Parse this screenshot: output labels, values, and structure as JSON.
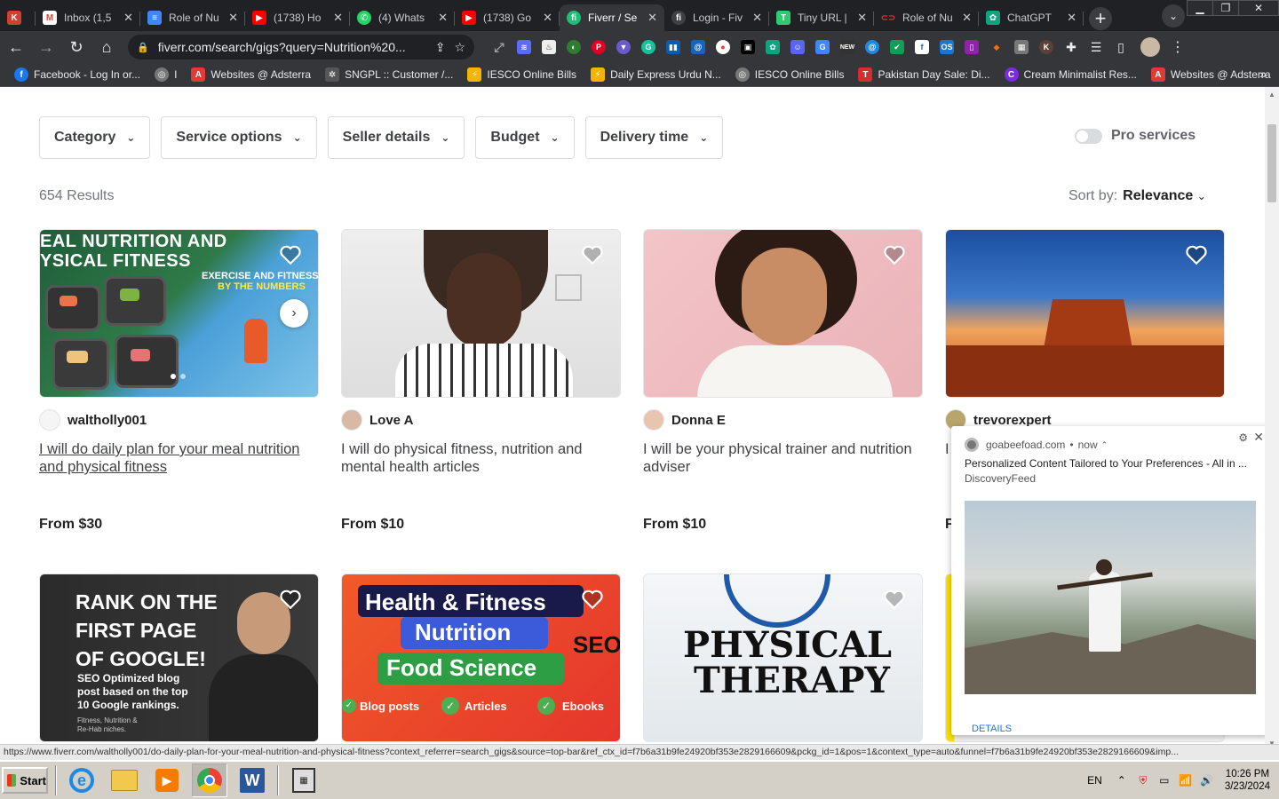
{
  "browser": {
    "tabs": [
      {
        "title": "",
        "icon": "k-icon",
        "color": "#d23f31"
      },
      {
        "title": "Inbox (1,5",
        "icon": "gmail-icon",
        "color": "#ea4335"
      },
      {
        "title": "Role of Nu",
        "icon": "docs-icon",
        "color": "#4285f4"
      },
      {
        "title": "(1738) Ho",
        "icon": "youtube-icon",
        "color": "#ff0000"
      },
      {
        "title": "(4) Whats",
        "icon": "whatsapp-icon",
        "color": "#25d366"
      },
      {
        "title": "(1738) Go",
        "icon": "youtube-icon",
        "color": "#ff0000"
      },
      {
        "title": "Fiverr / Se",
        "icon": "fiverr-icon",
        "color": "#1dbf73"
      },
      {
        "title": "Login - Fiv",
        "icon": "fiverr-icon",
        "color": "#404145"
      },
      {
        "title": "Tiny URL |",
        "icon": "tinyurl-icon",
        "color": "#2ecc71"
      },
      {
        "title": "Role of Nu",
        "icon": "link-icon",
        "color": "#e53935"
      },
      {
        "title": "ChatGPT",
        "icon": "chatgpt-icon",
        "color": "#10a37f"
      }
    ],
    "url": "fiverr.com/search/gigs?query=Nutrition%20...",
    "bookmarks": [
      {
        "label": "Facebook - Log In or...",
        "icon": "facebook-icon",
        "color": "#1877f2"
      },
      {
        "label": "I",
        "icon": "globe-icon",
        "color": "#777777"
      },
      {
        "label": "Websites @ Adsterra",
        "icon": "adsterra-icon",
        "color": "#e53935"
      },
      {
        "label": "SNGPL :: Customer /...",
        "icon": "sngpl-icon",
        "color": "#555555"
      },
      {
        "label": "IESCO Online Bills",
        "icon": "iesco-icon",
        "color": "#f4b400"
      },
      {
        "label": "Daily Express Urdu N...",
        "icon": "express-icon",
        "color": "#f4b400"
      },
      {
        "label": "IESCO Online Bills",
        "icon": "globe-icon",
        "color": "#777777"
      },
      {
        "label": "Pakistan Day Sale: Di...",
        "icon": "temu-icon",
        "color": "#d32f2f"
      },
      {
        "label": "Cream Minimalist Res...",
        "icon": "canva-icon",
        "color": "#7d2ae8"
      },
      {
        "label": "Websites @ Adsterra",
        "icon": "adsterra-icon",
        "color": "#e53935"
      }
    ]
  },
  "filters": [
    "Category",
    "Service options",
    "Seller details",
    "Budget",
    "Delivery time"
  ],
  "pro_label": "Pro services",
  "results_label": "654 Results",
  "sort_label": "Sort by:",
  "sort_value": "Relevance",
  "gigs": [
    {
      "seller": "waltholly001",
      "title": "I will do daily plan for your meal nutrition and physical fitness",
      "price": "From $30",
      "thumb_text1": "EAL NUTRITION AND",
      "thumb_text2": "YSICAL FITNESS",
      "thumb_text3": "EXERCISE AND FITNESS",
      "thumb_text4": "BY THE NUMBERS"
    },
    {
      "seller": "Love A",
      "title": "I will do physical fitness, nutrition and mental health articles",
      "price": "From $10"
    },
    {
      "seller": "Donna E",
      "title": "I will be your physical trainer and nutrition adviser",
      "price": "From $10"
    },
    {
      "seller": "trevorexpert",
      "title": "I",
      "price": "F"
    }
  ],
  "gigs_row2": [
    {
      "line1": "RANK ON THE",
      "line2": "FIRST PAGE",
      "line3": "OF GOOGLE!",
      "sub1": "SEO Optimized blog",
      "sub2": "post based on the top",
      "sub3": "10 Google rankings.",
      "tiny1": "Fitness, Nutrition &",
      "tiny2": "Re-Hab niches."
    },
    {
      "line1": "Health & Fitness",
      "line2": "Nutrition",
      "line3": "Food Science",
      "seo": "SEO",
      "b1": "Blog posts",
      "b2": "Articles",
      "b3": "Ebooks"
    },
    {
      "line1": "PHYSICAL",
      "line2": "THERAPY"
    }
  ],
  "notification": {
    "site": "goabeefoad.com",
    "time": "now",
    "message": "Personalized Content Tailored to Your Preferences - All in ...",
    "source": "DiscoveryFeed",
    "details": "DETAILS"
  },
  "status_url": "https://www.fiverr.com/waltholly001/do-daily-plan-for-your-meal-nutrition-and-physical-fitness?context_referrer=search_gigs&source=top-bar&ref_ctx_id=f7b6a31b9fe24920bf353e2829166609&pckg_id=1&pos=1&context_type=auto&funnel=f7b6a31b9fe24920bf353e2829166609&imp...",
  "taskbar": {
    "start": "Start",
    "lang": "EN",
    "time": "10:26 PM",
    "date": "3/23/2024"
  }
}
